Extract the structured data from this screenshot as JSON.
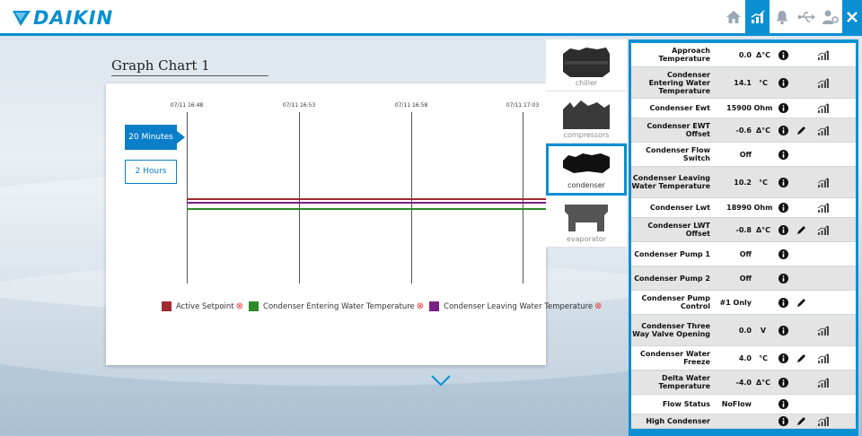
{
  "brand": {
    "name": "DAIKIN",
    "accent": "#0a8fd3"
  },
  "toolbar": {
    "icons": [
      "home-icon",
      "trend-chart-icon",
      "bell-icon",
      "usb-icon",
      "user-settings-icon",
      "close-icon"
    ],
    "active": "trend-chart-icon"
  },
  "chart": {
    "title": "Graph Chart 1",
    "time_labels": [
      "07/11 16:48",
      "07/11 16:53",
      "07/11 16:58",
      "07/11 17:03"
    ],
    "ranges": [
      "20 Minutes",
      "2 Hours"
    ],
    "selected_range": "20 Minutes",
    "legend": [
      {
        "label": "Active Setpoint",
        "color": "#a02a32"
      },
      {
        "label": "Condenser Entering Water Temperature",
        "color": "#2a8a2a"
      },
      {
        "label": "Condenser Leaving Water Temperature",
        "color": "#7a1f86"
      }
    ]
  },
  "components": [
    {
      "label": "chiller",
      "selected": false
    },
    {
      "label": "compressors",
      "selected": false
    },
    {
      "label": "condenser",
      "selected": true
    },
    {
      "label": "evaporator",
      "selected": false
    }
  ],
  "parameters": [
    {
      "name": "Approach Temperature",
      "value": "0.0",
      "unit": "Δ°C",
      "editable": false,
      "trend": true
    },
    {
      "name": "Condenser Entering Water Temperature",
      "value": "14.1",
      "unit": "°C",
      "editable": false,
      "trend": true
    },
    {
      "name": "Condenser Ewt",
      "value": "15900",
      "unit": "Ohm",
      "editable": false,
      "trend": true
    },
    {
      "name": "Condenser EWT Offset",
      "value": "-0.6",
      "unit": "Δ°C",
      "editable": true,
      "trend": true
    },
    {
      "name": "Condenser Flow Switch",
      "value": "Off",
      "unit": "",
      "editable": false,
      "trend": false
    },
    {
      "name": "Condenser Leaving Water Temperature",
      "value": "10.2",
      "unit": "°C",
      "editable": false,
      "trend": true
    },
    {
      "name": "Condenser Lwt",
      "value": "18990",
      "unit": "Ohm",
      "editable": false,
      "trend": true
    },
    {
      "name": "Condenser LWT Offset",
      "value": "-0.8",
      "unit": "Δ°C",
      "editable": true,
      "trend": true
    },
    {
      "name": "Condenser Pump 1",
      "value": "Off",
      "unit": "",
      "editable": false,
      "trend": false
    },
    {
      "name": "Condenser Pump 2",
      "value": "Off",
      "unit": "",
      "editable": false,
      "trend": false
    },
    {
      "name": "Condenser Pump Control",
      "value": "#1 Only",
      "unit": "",
      "editable": true,
      "trend": false
    },
    {
      "name": "Condenser Three Way Valve Opening",
      "value": "0.0",
      "unit": "V",
      "editable": false,
      "trend": true
    },
    {
      "name": "Condenser Water Freeze",
      "value": "4.0",
      "unit": "°C",
      "editable": true,
      "trend": true
    },
    {
      "name": "Delta Water Temperature",
      "value": "-4.0",
      "unit": "Δ°C",
      "editable": false,
      "trend": true
    },
    {
      "name": "Flow Status",
      "value": "NoFlow",
      "unit": "",
      "editable": false,
      "trend": false
    },
    {
      "name": "High Condenser",
      "value": "",
      "unit": "",
      "editable": true,
      "trend": true
    }
  ]
}
